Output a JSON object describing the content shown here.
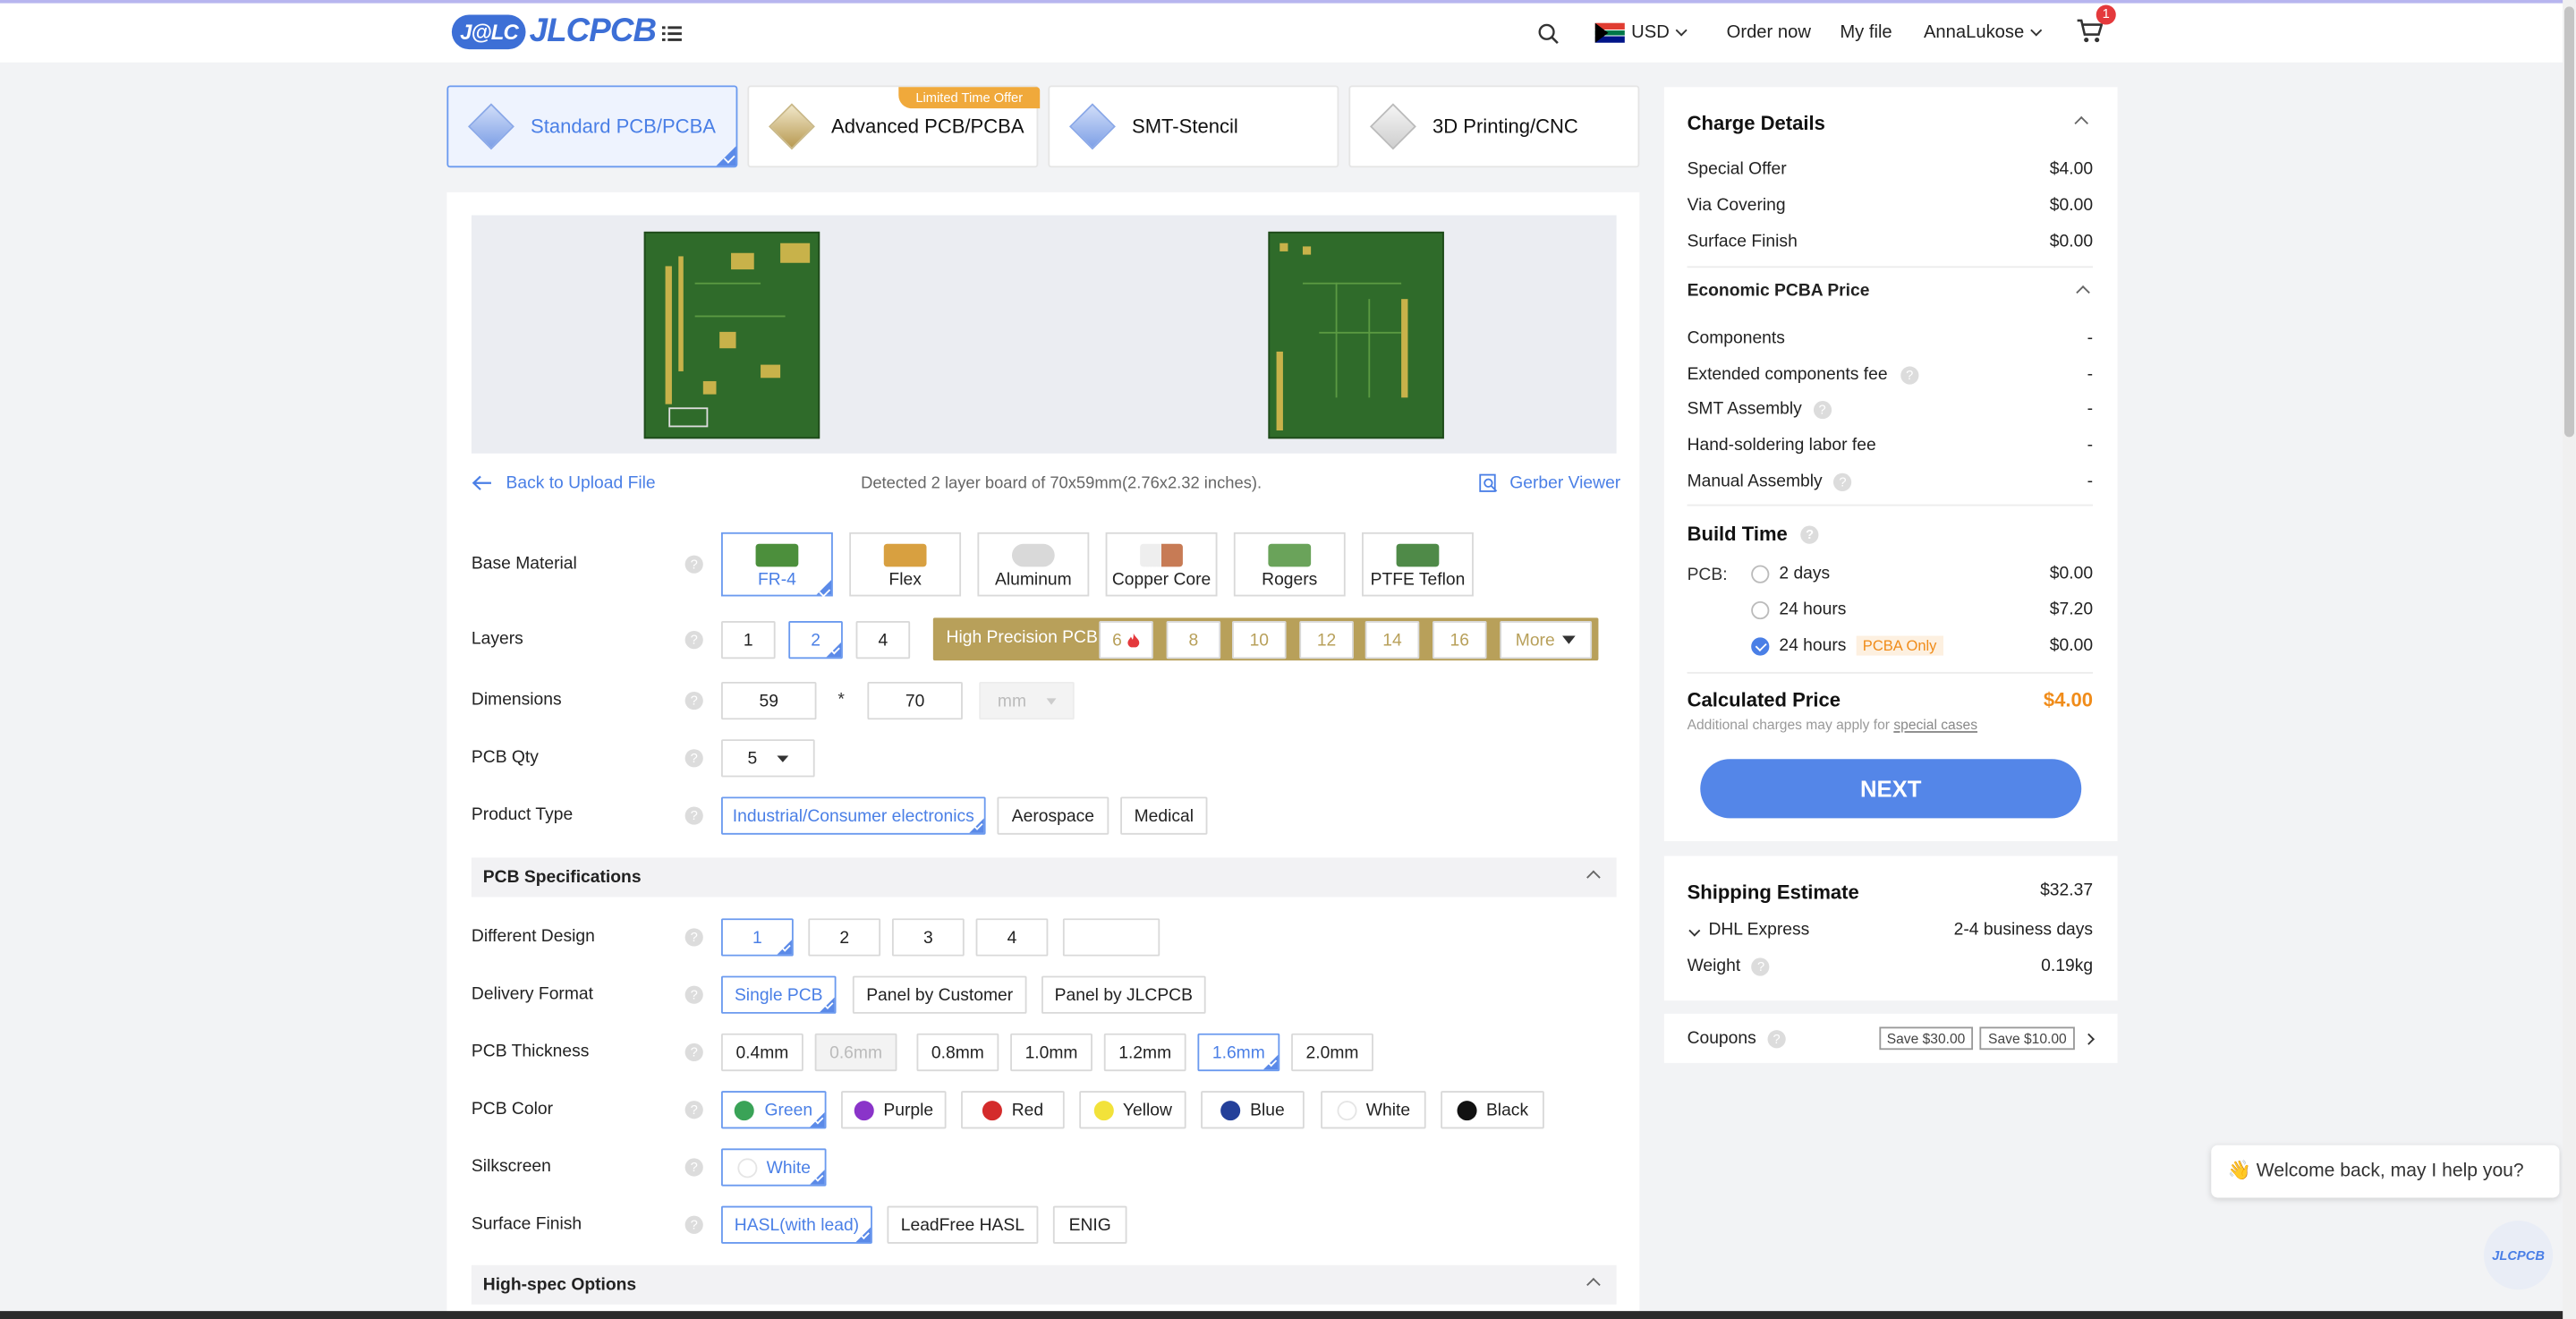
{
  "header": {
    "logo_mark": "J@LC",
    "logo_text": "JLCPCB",
    "currency": "USD",
    "order_now": "Order now",
    "my_file": "My file",
    "user": "AnnaLukose",
    "cart_count": "1"
  },
  "product_tabs": [
    {
      "label": "Standard PCB/PCBA",
      "selected": true
    },
    {
      "label": "Advanced PCB/PCBA",
      "selected": false
    },
    {
      "label": "SMT-Stencil",
      "selected": false
    },
    {
      "label": "3D Printing/CNC",
      "selected": false
    }
  ],
  "ribbon": "Limited Time Offer",
  "preview": {
    "back_link": "Back to Upload File",
    "detected": "Detected 2 layer board of 70x59mm(2.76x2.32 inches).",
    "gerber_viewer": "Gerber Viewer"
  },
  "form": {
    "base_material": {
      "label": "Base Material",
      "options": [
        "FR-4",
        "Flex",
        "Aluminum",
        "Copper Core",
        "Rogers",
        "PTFE Teflon"
      ],
      "selected": "FR-4"
    },
    "layers": {
      "label": "Layers",
      "options": [
        "1",
        "2",
        "4"
      ],
      "selected": "2",
      "high_precision_label": "High Precision PCB",
      "hp_options": [
        "6",
        "8",
        "10",
        "12",
        "14",
        "16"
      ],
      "more": "More"
    },
    "dimensions": {
      "label": "Dimensions",
      "width": "59",
      "height": "70",
      "sep": "*",
      "unit": "mm"
    },
    "qty": {
      "label": "PCB Qty",
      "value": "5"
    },
    "product_type": {
      "label": "Product Type",
      "options": [
        "Industrial/Consumer electronics",
        "Aerospace",
        "Medical"
      ],
      "selected": "Industrial/Consumer electronics"
    },
    "pcb_spec_heading": "PCB Specifications",
    "different_design": {
      "label": "Different Design",
      "options": [
        "1",
        "2",
        "3",
        "4"
      ],
      "selected": "1"
    },
    "delivery_format": {
      "label": "Delivery Format",
      "options": [
        "Single PCB",
        "Panel by Customer",
        "Panel by JLCPCB"
      ],
      "selected": "Single PCB"
    },
    "thickness": {
      "label": "PCB Thickness",
      "options": [
        "0.4mm",
        "0.6mm",
        "0.8mm",
        "1.0mm",
        "1.2mm",
        "1.6mm",
        "2.0mm"
      ],
      "selected": "1.6mm",
      "disabled": "0.6mm"
    },
    "color": {
      "label": "PCB Color",
      "options": [
        {
          "name": "Green",
          "hex": "#3aa357"
        },
        {
          "name": "Purple",
          "hex": "#8a34c9"
        },
        {
          "name": "Red",
          "hex": "#d42b2b"
        },
        {
          "name": "Yellow",
          "hex": "#f2e23a"
        },
        {
          "name": "Blue",
          "hex": "#24409a"
        },
        {
          "name": "White",
          "hex": "#ffffff"
        },
        {
          "name": "Black",
          "hex": "#111111"
        }
      ],
      "selected": "Green"
    },
    "silkscreen": {
      "label": "Silkscreen",
      "value": "White"
    },
    "surface_finish": {
      "label": "Surface Finish",
      "options": [
        "HASL(with lead)",
        "LeadFree HASL",
        "ENIG"
      ],
      "selected": "HASL(with lead)"
    },
    "high_spec_heading": "High-spec Options"
  },
  "charge": {
    "title": "Charge Details",
    "rows": [
      {
        "label": "Special Offer",
        "value": "$4.00"
      },
      {
        "label": "Via Covering",
        "value": "$0.00"
      },
      {
        "label": "Surface Finish",
        "value": "$0.00"
      }
    ],
    "pcba_title": "Economic PCBA Price",
    "pcba_rows": [
      {
        "label": "Components",
        "value": "-"
      },
      {
        "label": "Extended components fee",
        "value": "-"
      },
      {
        "label": "SMT Assembly",
        "value": "-"
      },
      {
        "label": "Hand-soldering labor fee",
        "value": "-"
      },
      {
        "label": "Manual Assembly",
        "value": "-"
      }
    ],
    "build_time_title": "Build Time",
    "pcb_label": "PCB:",
    "build_options": [
      {
        "label": "2 days",
        "price": "$0.00",
        "checked": false,
        "tag": ""
      },
      {
        "label": "24 hours",
        "price": "$7.20",
        "checked": false,
        "tag": ""
      },
      {
        "label": "24 hours",
        "price": "$0.00",
        "checked": true,
        "tag": "PCBA Only"
      }
    ],
    "calc_label": "Calculated Price",
    "calc_value": "$4.00",
    "note_prefix": "Additional charges may apply for ",
    "note_link": "special cases",
    "next": "NEXT"
  },
  "shipping": {
    "title": "Shipping Estimate",
    "price": "$32.37",
    "carrier": "DHL Express",
    "days": "2-4 business days",
    "weight_label": "Weight",
    "weight": "0.19kg"
  },
  "coupons": {
    "label": "Coupons",
    "items": [
      "Save $30.00",
      "Save $10.00"
    ]
  },
  "chat": {
    "message": "Welcome back, may I help you?",
    "emoji": "👋",
    "button": "JLCPCB"
  },
  "colors": {
    "accent": "#4a7fe6",
    "price": "#f08c1a",
    "high_precision": "#b8a05a"
  }
}
